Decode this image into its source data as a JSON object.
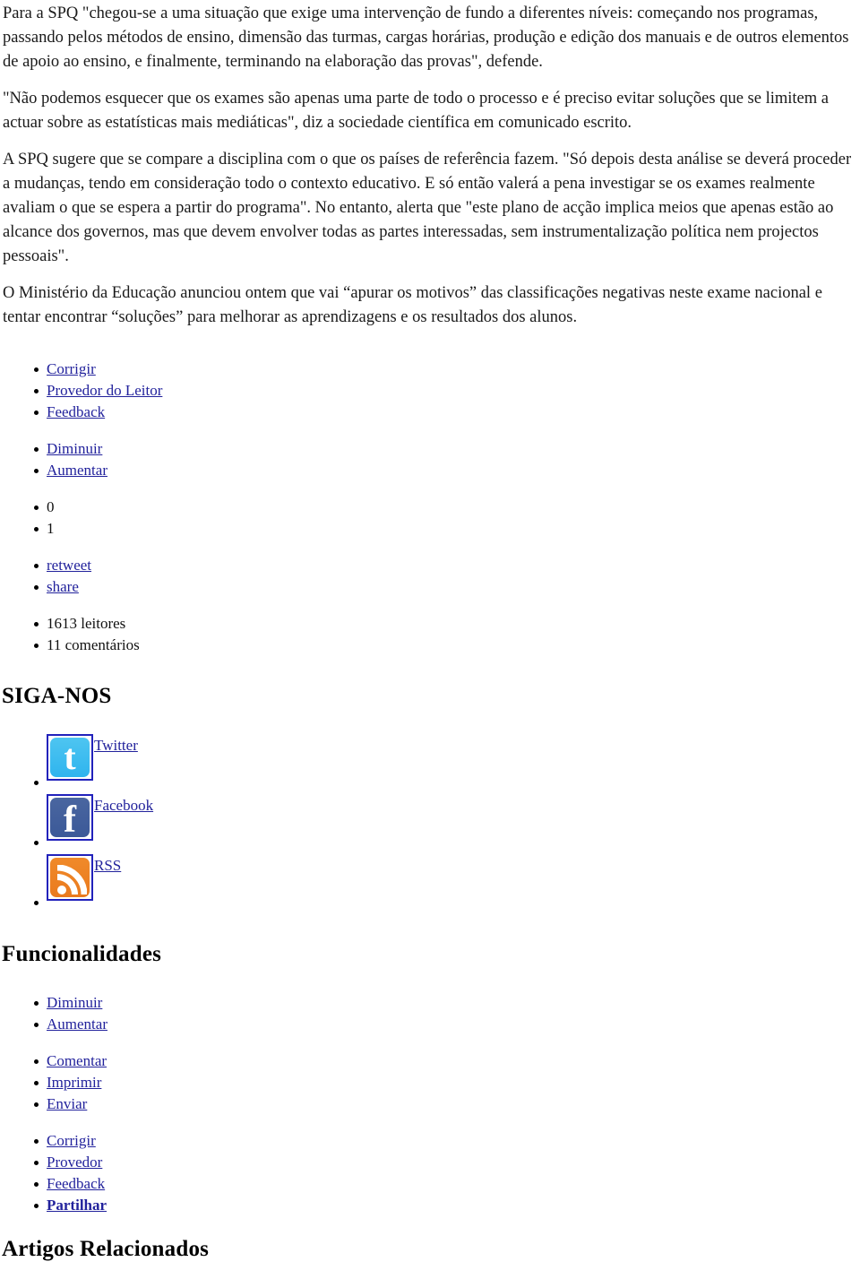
{
  "article": {
    "paragraphs": [
      "Para a SPQ \"chegou-se a uma situação que exige uma intervenção de fundo a diferentes níveis: começando nos programas, passando pelos métodos de ensino, dimensão das turmas, cargas horárias, produção e edição dos manuais e de outros elementos de apoio ao ensino, e finalmente, terminando na elaboração das provas\", defende.",
      "\"Não podemos esquecer que os exames são apenas uma parte de todo o processo e é preciso evitar soluções que se limitem a actuar sobre as estatísticas mais mediáticas\", diz a sociedade científica em comunicado escrito.",
      "A SPQ sugere que se compare a disciplina com o que os países de referência fazem. \"Só depois desta análise se deverá proceder a mudanças, tendo em consideração todo o contexto educativo. E só então valerá a pena investigar se os exames realmente avaliam o que se espera a partir do programa\". No entanto, alerta que \"este plano de acção implica meios que apenas estão ao alcance dos governos, mas que devem envolver todas as partes interessadas, sem instrumentalização política nem projectos pessoais\".",
      "O Ministério da Educação anunciou ontem que vai “apurar os motivos” das classificações negativas neste exame nacional e tentar encontrar “soluções” para melhorar as aprendizagens e os resultados dos alunos."
    ]
  },
  "toolbar": {
    "group1": [
      {
        "label": "Corrigir",
        "type": "link"
      },
      {
        "label": "Provedor do Leitor",
        "type": "link"
      },
      {
        "label": "Feedback",
        "type": "link"
      }
    ],
    "group2": [
      {
        "label": "Diminuir",
        "type": "link"
      },
      {
        "label": "Aumentar",
        "type": "link"
      }
    ],
    "group3": [
      {
        "label": "0",
        "type": "text"
      },
      {
        "label": "1",
        "type": "text"
      }
    ],
    "group4": [
      {
        "label": "retweet",
        "type": "link"
      },
      {
        "label": "share",
        "type": "link"
      }
    ],
    "group5": [
      {
        "label": "1613 leitores",
        "type": "text"
      },
      {
        "label": "11 comentários",
        "type": "text"
      }
    ]
  },
  "follow": {
    "title": "SIGA-NOS",
    "items": [
      {
        "label": "Twitter",
        "icon": "twitter-icon",
        "color": "#2fb4ee"
      },
      {
        "label": "Facebook",
        "icon": "facebook-icon",
        "color": "#3b5998"
      },
      {
        "label": "RSS",
        "icon": "rss-icon",
        "color": "#ea7a1e"
      }
    ]
  },
  "features": {
    "title": "Funcionalidades",
    "group1": [
      {
        "label": "Diminuir",
        "bold": false
      },
      {
        "label": "Aumentar",
        "bold": false
      }
    ],
    "group2": [
      {
        "label": "Comentar",
        "bold": false
      },
      {
        "label": "Imprimir",
        "bold": false
      },
      {
        "label": "Enviar",
        "bold": false
      }
    ],
    "group3": [
      {
        "label": "Corrigir",
        "bold": false
      },
      {
        "label": "Provedor",
        "bold": false
      },
      {
        "label": "Feedback",
        "bold": false
      },
      {
        "label": "Partilhar",
        "bold": true
      }
    ]
  },
  "related": {
    "title": "Artigos Relacionados"
  },
  "colors": {
    "link": "#22229c",
    "text": "#111111",
    "background": "#ffffff"
  }
}
